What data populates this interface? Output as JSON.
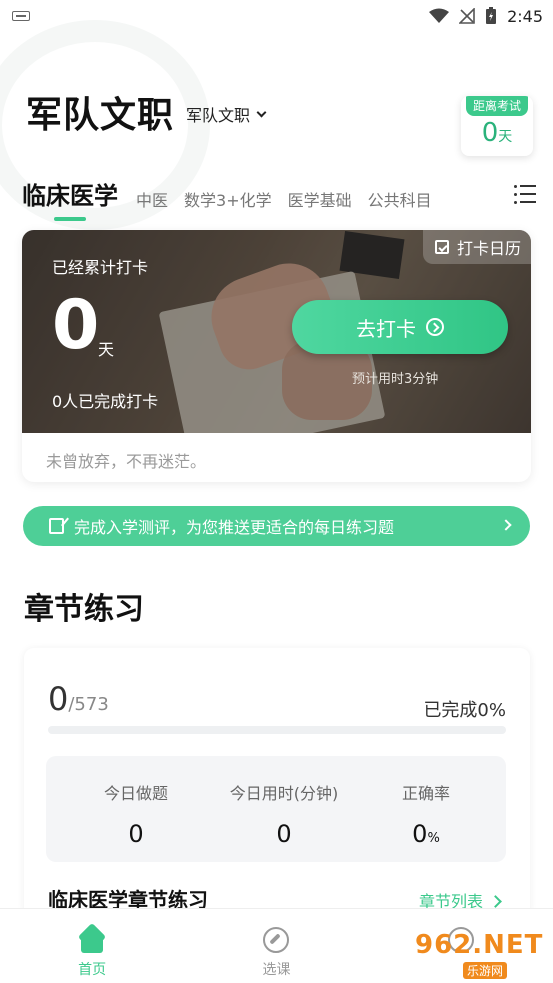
{
  "status_bar": {
    "time": "2:45"
  },
  "header": {
    "title": "军队文职",
    "selector_label": "军队文职"
  },
  "exam_countdown": {
    "label": "距离考试",
    "value": "0",
    "unit": "天"
  },
  "tabs": [
    {
      "label": "临床医学",
      "active": true
    },
    {
      "label": "中医"
    },
    {
      "label": "数学3+化学"
    },
    {
      "label": "医学基础"
    },
    {
      "label": "公共科目"
    }
  ],
  "checkin": {
    "calendar_label": "打卡日历",
    "cumulative_label": "已经累计打卡",
    "days": "0",
    "days_unit": "天",
    "completed_people": "0人已完成打卡",
    "button_label": "去打卡",
    "estimate": "预计用时3分钟",
    "motto": "未曾放弃，不再迷茫。"
  },
  "banner": {
    "text": "完成入学测评，为您推送更适合的每日练习题"
  },
  "chapter_practice": {
    "section_title": "章节练习",
    "done": "0",
    "total": "/573",
    "completed_pct_label": "已完成0%",
    "progress": 0,
    "stats": [
      {
        "label": "今日做题",
        "value": "0",
        "unit": ""
      },
      {
        "label": "今日用时(分钟)",
        "value": "0",
        "unit": ""
      },
      {
        "label": "正确率",
        "value": "0",
        "unit": "%"
      }
    ],
    "list_title": "临床医学章节练习",
    "list_link": "章节列表"
  },
  "bottom_nav": [
    {
      "label": "首页",
      "icon": "home-icon",
      "active": true
    },
    {
      "label": "选课",
      "icon": "compass-icon"
    },
    {
      "label": "",
      "icon": "user-icon"
    }
  ],
  "watermark": {
    "text": "962.NET",
    "sub": "乐游网"
  },
  "colors": {
    "accent": "#3cc98c",
    "banner": "#4ecf97"
  }
}
